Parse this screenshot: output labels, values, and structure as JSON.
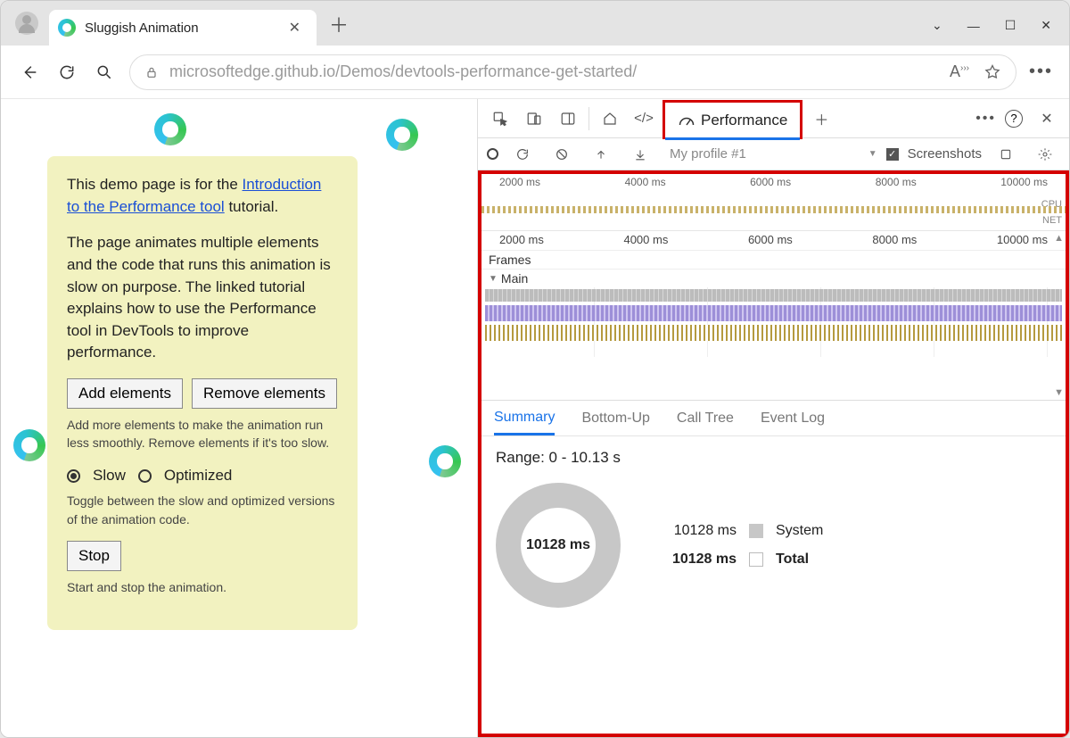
{
  "window": {
    "tab_title": "Sluggish Animation",
    "url_grey_prefix": "microsoftedge.github.io",
    "url_rest": "/Demos/devtools-performance-get-started/"
  },
  "page": {
    "intro_prefix": "This demo page is for the ",
    "intro_link": "Introduction to the Performance tool",
    "intro_suffix": " tutorial.",
    "desc": "The page animates multiple elements and the code that runs this animation is slow on purpose. The linked tutorial explains how to use the Performance tool in DevTools to improve performance.",
    "add_btn": "Add elements",
    "remove_btn": "Remove elements",
    "add_hint": "Add more elements to make the animation run less smoothly. Remove elements if it's too slow.",
    "radio_slow": "Slow",
    "radio_opt": "Optimized",
    "radio_hint": "Toggle between the slow and optimized versions of the animation code.",
    "stop_btn": "Stop",
    "stop_hint": "Start and stop the animation."
  },
  "devtools": {
    "perf_tab": "Performance",
    "profile_name": "My profile #1",
    "screenshots_label": "Screenshots",
    "overview_ticks": [
      "2000 ms",
      "4000 ms",
      "6000 ms",
      "8000 ms",
      "10000 ms"
    ],
    "overview_cpu": "CPU",
    "overview_net": "NET",
    "frames_label": "Frames",
    "main_label": "Main",
    "summary_tabs": {
      "summary": "Summary",
      "bottomup": "Bottom-Up",
      "calltree": "Call Tree",
      "eventlog": "Event Log"
    },
    "range": "Range: 0 - 10.13 s",
    "donut_center": "10128 ms",
    "legend_system_ms": "10128 ms",
    "legend_system": "System",
    "legend_total_ms": "10128 ms",
    "legend_total": "Total"
  },
  "chart_data": {
    "type": "pie",
    "title": "Time breakdown",
    "series": [
      {
        "name": "System",
        "value": 10128,
        "unit": "ms"
      }
    ],
    "total": {
      "name": "Total",
      "value": 10128,
      "unit": "ms"
    },
    "range_seconds": [
      0,
      10.13
    ]
  }
}
